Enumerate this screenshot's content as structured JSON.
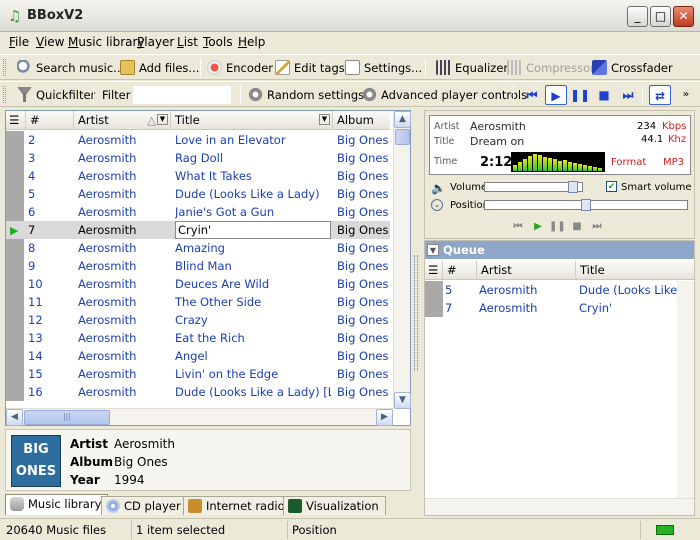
{
  "window": {
    "title": "BBoxV2"
  },
  "menu": [
    "File",
    "View",
    "Music library",
    "Player",
    "List",
    "Tools",
    "Help"
  ],
  "toolbar1": {
    "search": "Search music...",
    "add_files": "Add files...",
    "encoder": "Encoder",
    "edit_tags": "Edit tags",
    "settings": "Settings...",
    "equalizer": "Equalizer",
    "compressor": "Compressor",
    "crossfader": "Crossfader"
  },
  "toolbar2": {
    "quickfilter": "Quickfilter",
    "filter_label": "Filter",
    "filter_value": "",
    "random_settings": "Random settings",
    "advanced_player_controls": "Advanced player controls"
  },
  "library": {
    "columns": {
      "num": "#",
      "artist": "Artist",
      "title": "Title",
      "album": "Album"
    },
    "rows": [
      {
        "num": "2",
        "artist": "Aerosmith",
        "title": "Love in an Elevator",
        "album": "Big Ones"
      },
      {
        "num": "3",
        "artist": "Aerosmith",
        "title": "Rag Doll",
        "album": "Big Ones"
      },
      {
        "num": "4",
        "artist": "Aerosmith",
        "title": "What It Takes",
        "album": "Big Ones"
      },
      {
        "num": "5",
        "artist": "Aerosmith",
        "title": "Dude (Looks Like a Lady)",
        "album": "Big Ones"
      },
      {
        "num": "6",
        "artist": "Aerosmith",
        "title": "Janie's Got a Gun",
        "album": "Big Ones"
      },
      {
        "num": "7",
        "artist": "Aerosmith",
        "title": "Cryin'",
        "album": "Big Ones"
      },
      {
        "num": "8",
        "artist": "Aerosmith",
        "title": "Amazing",
        "album": "Big Ones"
      },
      {
        "num": "9",
        "artist": "Aerosmith",
        "title": "Blind Man",
        "album": "Big Ones"
      },
      {
        "num": "10",
        "artist": "Aerosmith",
        "title": "Deuces Are Wild",
        "album": "Big Ones"
      },
      {
        "num": "11",
        "artist": "Aerosmith",
        "title": "The Other Side",
        "album": "Big Ones"
      },
      {
        "num": "12",
        "artist": "Aerosmith",
        "title": "Crazy",
        "album": "Big Ones"
      },
      {
        "num": "13",
        "artist": "Aerosmith",
        "title": "Eat the Rich",
        "album": "Big Ones"
      },
      {
        "num": "14",
        "artist": "Aerosmith",
        "title": "Angel",
        "album": "Big Ones"
      },
      {
        "num": "15",
        "artist": "Aerosmith",
        "title": "Livin' on the Edge",
        "album": "Big Ones"
      },
      {
        "num": "16",
        "artist": "Aerosmith",
        "title": "Dude (Looks Like a Lady) [Live]",
        "album": "Big Ones"
      }
    ],
    "current_index": 5
  },
  "album_info": {
    "artist_label": "Artist",
    "artist": "Aerosmith",
    "album_label": "Album",
    "album": "Big Ones",
    "year_label": "Year",
    "year": "1994",
    "cover_text": "BIG ONES"
  },
  "tabs": [
    "Music library",
    "CD player",
    "Internet radio",
    "Visualization"
  ],
  "player": {
    "artist_label": "Artist",
    "artist": "Aerosmith",
    "title_label": "Title",
    "title": "Dream on",
    "time_label": "Time",
    "time": "2:12",
    "bitrate": "234",
    "bitrate_unit": "Kbps",
    "samplerate": "44.1",
    "samplerate_unit": "Khz",
    "format_label": "Format",
    "format": "MP3",
    "volume_label": "Volume",
    "volume": 0.95,
    "smart_volume_label": "Smart volume",
    "smart_volume": true,
    "position_label": "Position",
    "position": 0.5
  },
  "queue": {
    "title": "Queue",
    "columns": {
      "num": "#",
      "artist": "Artist",
      "title": "Title"
    },
    "rows": [
      {
        "num": "5",
        "artist": "Aerosmith",
        "title": "Dude (Looks Like a Lady)"
      },
      {
        "num": "7",
        "artist": "Aerosmith",
        "title": "Cryin'"
      }
    ]
  },
  "status": {
    "files": "20640 Music files",
    "selected": "1 item selected",
    "position": "Position"
  },
  "colors": {
    "link_blue": "#1a3fb0",
    "queue_header": "#8ea7c9",
    "accent_red": "#cc2222"
  }
}
